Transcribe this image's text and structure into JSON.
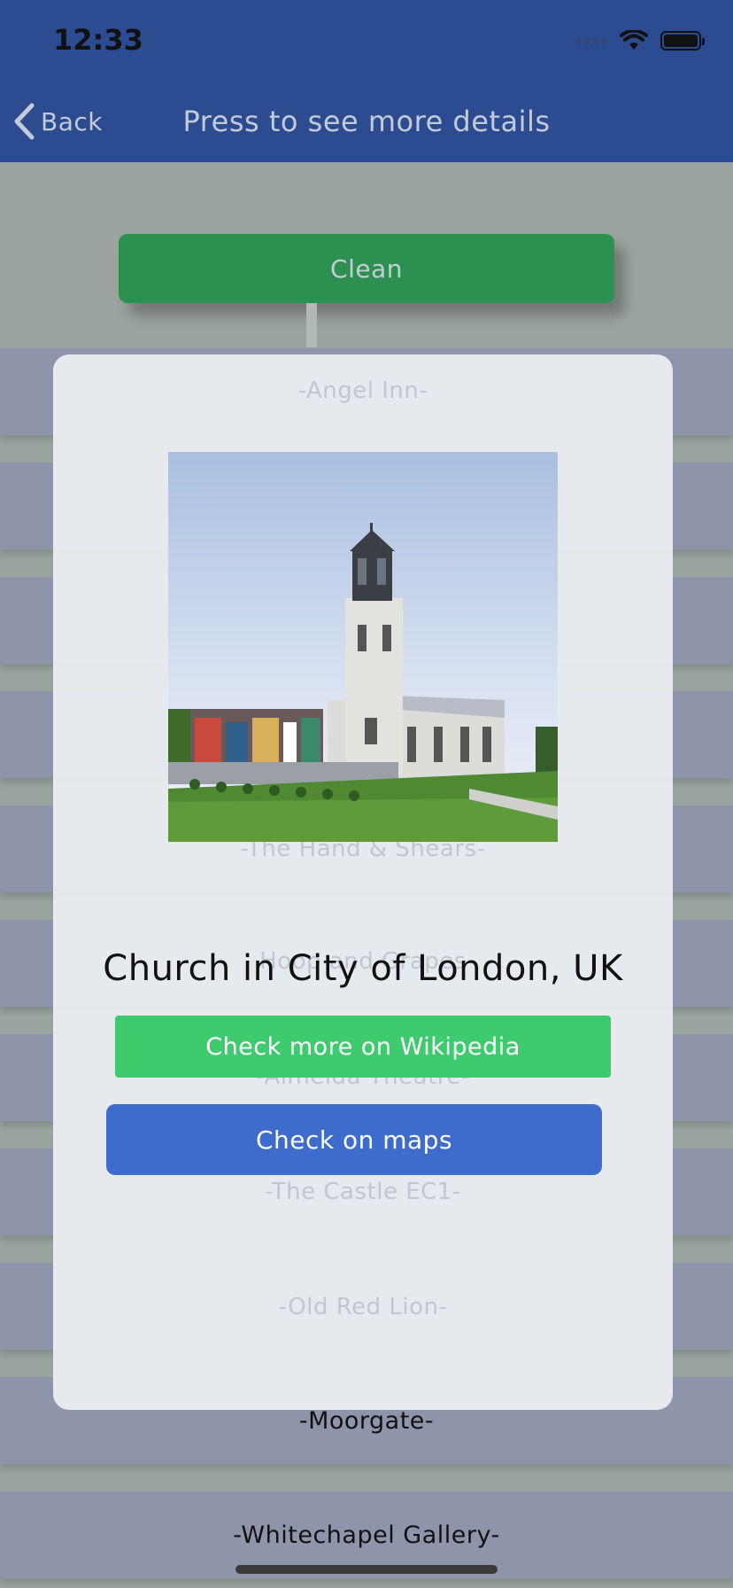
{
  "status_bar": {
    "time": "12:33"
  },
  "nav": {
    "back_label": "Back",
    "title": "Press to see more details"
  },
  "main": {
    "clean_label": "Clean"
  },
  "list": {
    "items": [
      "-Moorgate-",
      "-Whitechapel Gallery-"
    ]
  },
  "ghost_items": [
    "-Angel Inn-",
    "-The Hand & Shears-",
    "Hoop and Grapes",
    "-Almeida Theatre-",
    "-The Castle EC1-",
    "-Old Red Lion-"
  ],
  "popup": {
    "title": "Church in City of London, UK",
    "wiki_label": "Check more on Wikipedia",
    "maps_label": "Check on maps"
  },
  "colors": {
    "nav_bar": "#2c4c92",
    "clean_button": "#2c9150",
    "wiki_button": "#3ecb6e",
    "maps_button": "#3d6ccd"
  }
}
